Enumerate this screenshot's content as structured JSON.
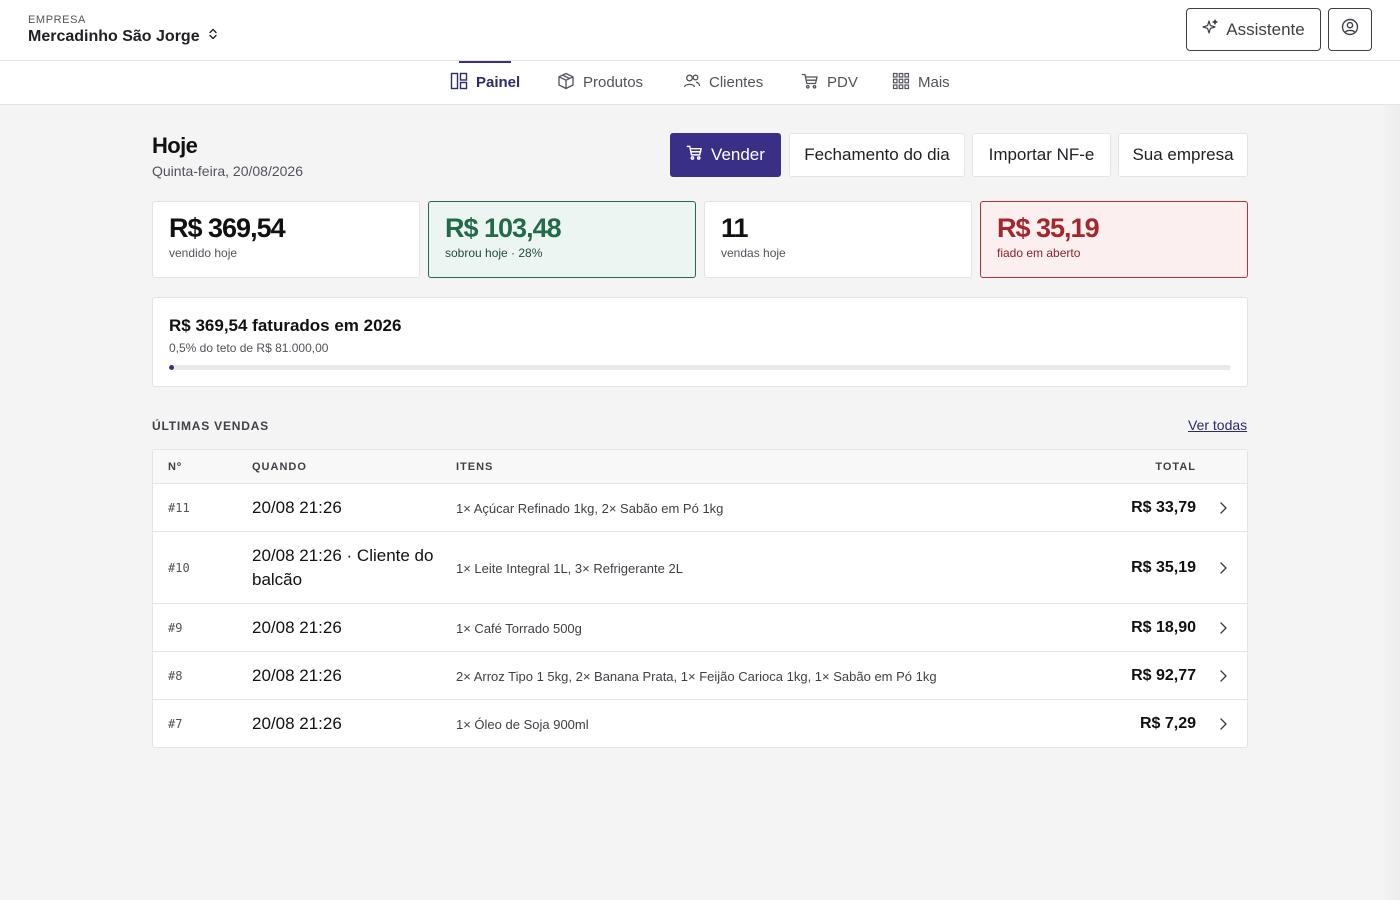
{
  "header": {
    "company_caption": "EMPRESA",
    "company_name": "Mercadinho São Jorge",
    "assistant_label": "Assistente"
  },
  "nav": {
    "items": [
      {
        "label": "Painel",
        "icon": "dashboard-icon",
        "active": true
      },
      {
        "label": "Produtos",
        "icon": "box-icon",
        "active": false
      },
      {
        "label": "Clientes",
        "icon": "users-icon",
        "active": false
      },
      {
        "label": "PDV",
        "icon": "cart-icon",
        "active": false
      },
      {
        "label": "Mais",
        "icon": "grid-icon",
        "active": false
      }
    ]
  },
  "page": {
    "title": "Hoje",
    "date": "Quinta-feira, 20/08/2026"
  },
  "actions": {
    "sell": "Vender",
    "close_day": "Fechamento do dia",
    "import_nfe": "Importar NF-e",
    "your_company": "Sua empresa"
  },
  "kpis": [
    {
      "value": "R$ 369,54",
      "label": "vendido hoje",
      "tone": "neutral"
    },
    {
      "value": "R$ 103,48",
      "label": "sobrou hoje · 28%",
      "tone": "positive"
    },
    {
      "value": "11",
      "label": "vendas hoje",
      "tone": "neutral"
    },
    {
      "value": "R$ 35,19",
      "label": "fiado em aberto",
      "tone": "negative"
    }
  ],
  "billing": {
    "title": "R$ 369,54 faturados em 2026",
    "subtitle": "0,5% do teto de R$ 81.000,00",
    "progress_fraction": 0.005
  },
  "recent_sales": {
    "title": "ÚLTIMAS VENDAS",
    "see_all": "Ver todas",
    "columns": {
      "num": "Nº",
      "when": "QUANDO",
      "items": "ITENS",
      "total": "TOTAL"
    },
    "rows": [
      {
        "num": "#11",
        "when": "20/08 21:26",
        "items": "1× Açúcar Refinado 1kg, 2× Sabão em Pó 1kg",
        "total": "R$ 33,79"
      },
      {
        "num": "#10",
        "when": "20/08 21:26 · Cliente do balcão",
        "items": "1× Leite Integral 1L, 3× Refrigerante 2L",
        "total": "R$ 35,19"
      },
      {
        "num": "#9",
        "when": "20/08 21:26",
        "items": "1× Café Torrado 500g",
        "total": "R$ 18,90"
      },
      {
        "num": "#8",
        "when": "20/08 21:26",
        "items": "2× Arroz Tipo 1 5kg, 2× Banana Prata, 1× Feijão Carioca 1kg, 1× Sabão em Pó 1kg",
        "total": "R$ 92,77"
      },
      {
        "num": "#7",
        "when": "20/08 21:26",
        "items": "1× Óleo de Soja 900ml",
        "total": "R$ 7,29"
      }
    ]
  },
  "colors": {
    "accent": "#3a2f86",
    "positive": "#1f6b4a",
    "negative": "#a3282d"
  }
}
